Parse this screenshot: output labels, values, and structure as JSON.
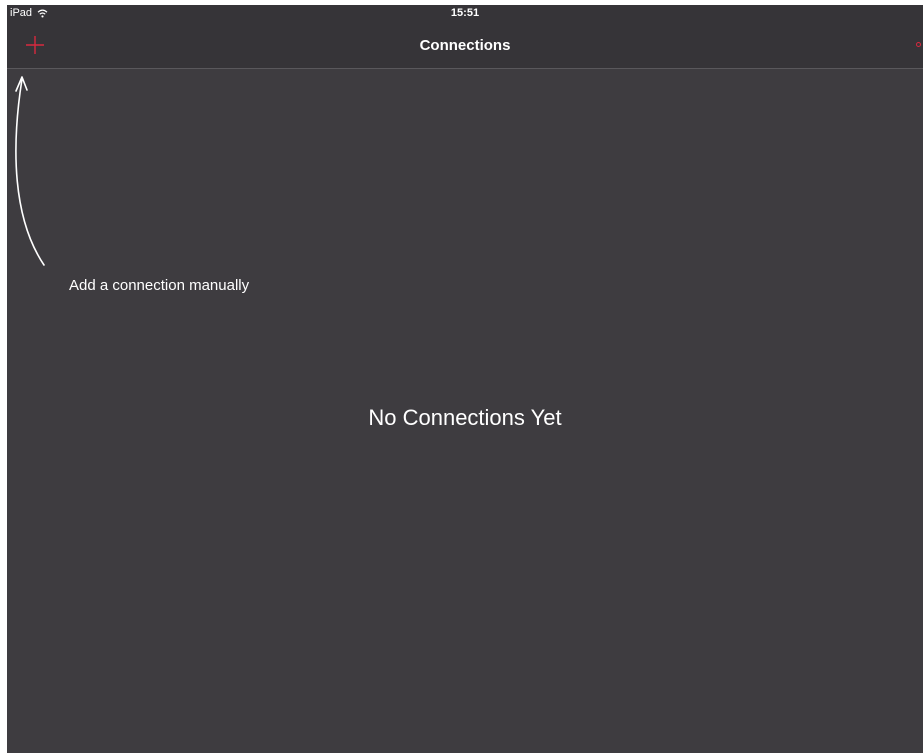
{
  "status_bar": {
    "device": "iPad",
    "time": "15:51"
  },
  "nav": {
    "title": "Connections",
    "add_icon": "plus-icon",
    "more_icon": "more-dots-icon"
  },
  "hint": {
    "text": "Add a connection manually",
    "arrow_icon": "curved-arrow-icon"
  },
  "empty_state": {
    "message": "No Connections Yet"
  },
  "colors": {
    "accent": "#d8293f",
    "background": "#3e3c40",
    "bar": "#363438",
    "text": "#ffffff"
  }
}
